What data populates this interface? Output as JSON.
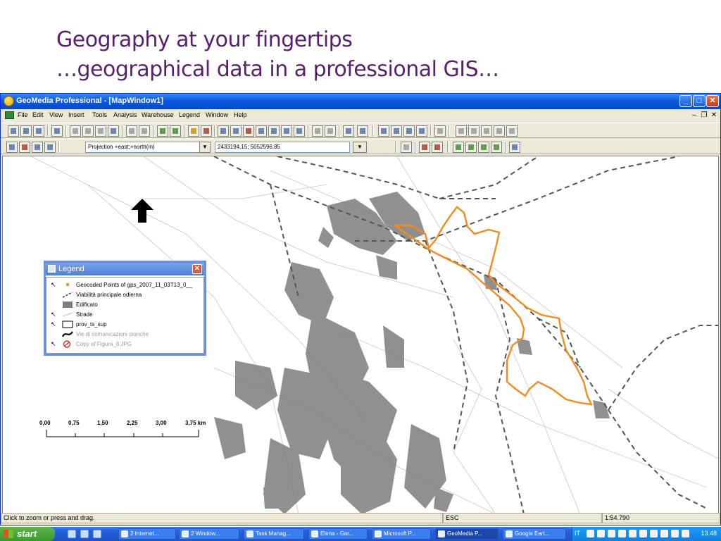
{
  "slide": {
    "title_line1": "Geography at your fingertips",
    "title_line2": "…geographical data in a professional GIS…"
  },
  "window": {
    "title": "GeoMedia Professional - [MapWindow1]",
    "minimize": "_",
    "maximize": "□",
    "close": "✕",
    "mdi_min": "–",
    "mdi_restore": "❐",
    "mdi_close": "✕"
  },
  "menu": [
    "File",
    "Edit",
    "View",
    "Insert",
    "Tools",
    "Analysis",
    "Warehouse",
    "Legend",
    "Window",
    "Help"
  ],
  "toolbar2": {
    "projection": "Projection +east;+north(m)",
    "coordinates": "2433194,15; 5052596,85",
    "dropdown_arrow": "▼"
  },
  "legend": {
    "title": "Legend",
    "close": "✕",
    "items": [
      {
        "label": "Geocoded Points of gps_2007_11_03T13_0__",
        "cursor": "↖",
        "symbol": "point-orange",
        "dim": false
      },
      {
        "label": "Viabilità principale odierna",
        "cursor": "",
        "symbol": "dashed-line",
        "dim": false
      },
      {
        "label": "Edificato",
        "cursor": "",
        "symbol": "gray-fill",
        "dim": false
      },
      {
        "label": "Strade",
        "cursor": "↖",
        "symbol": "thin-line",
        "dim": false
      },
      {
        "label": "prov_ts_sup",
        "cursor": "↖",
        "symbol": "empty-box",
        "dim": false
      },
      {
        "label": "Vie di comunicazioni storiche",
        "cursor": "",
        "symbol": "black-curve",
        "dim": true
      },
      {
        "label": "Copy of Figura_6.JPG",
        "cursor": "↖",
        "symbol": "image-icon",
        "dim": true
      }
    ]
  },
  "scale": {
    "labels": [
      "0,00",
      "0,75",
      "1,50",
      "2,25",
      "3,00",
      "3,75 km"
    ]
  },
  "north_arrow": "north-arrow",
  "status": {
    "message": "Click to zoom or press and drag.",
    "key": "ESC",
    "scale": "1:54.790"
  },
  "taskbar": {
    "start": "start",
    "tasks": [
      {
        "label": "2 Internet...",
        "active": false
      },
      {
        "label": "2 Window...",
        "active": false
      },
      {
        "label": "Task Manag...",
        "active": false
      },
      {
        "label": "Elena - Gar...",
        "active": false
      },
      {
        "label": "Microsoft P...",
        "active": false
      },
      {
        "label": "GeoMedia P...",
        "active": true
      },
      {
        "label": "Google Eart...",
        "active": false
      }
    ],
    "language": "IT",
    "clock": "13.48"
  },
  "colors": {
    "title_purple": "#5a1e6e",
    "gps_track": "#f28c1e",
    "built_up": "#7d7d7d",
    "roads_dashed": "#555555"
  }
}
